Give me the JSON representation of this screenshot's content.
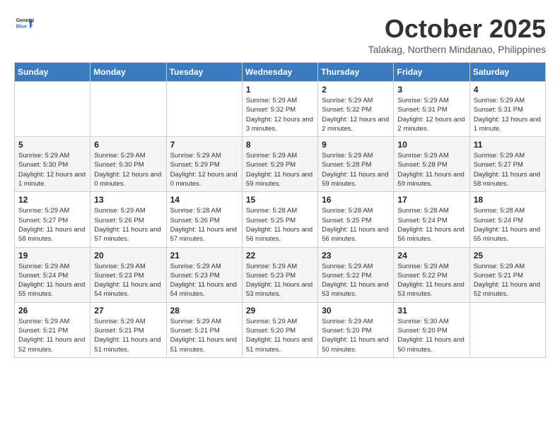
{
  "header": {
    "logo_general": "General",
    "logo_blue": "Blue",
    "month": "October 2025",
    "location": "Talakag, Northern Mindanao, Philippines"
  },
  "weekdays": [
    "Sunday",
    "Monday",
    "Tuesday",
    "Wednesday",
    "Thursday",
    "Friday",
    "Saturday"
  ],
  "weeks": [
    [
      {
        "day": "",
        "info": ""
      },
      {
        "day": "",
        "info": ""
      },
      {
        "day": "",
        "info": ""
      },
      {
        "day": "1",
        "info": "Sunrise: 5:29 AM\nSunset: 5:32 PM\nDaylight: 12 hours and 3 minutes."
      },
      {
        "day": "2",
        "info": "Sunrise: 5:29 AM\nSunset: 5:32 PM\nDaylight: 12 hours and 2 minutes."
      },
      {
        "day": "3",
        "info": "Sunrise: 5:29 AM\nSunset: 5:31 PM\nDaylight: 12 hours and 2 minutes."
      },
      {
        "day": "4",
        "info": "Sunrise: 5:29 AM\nSunset: 5:31 PM\nDaylight: 12 hours and 1 minute."
      }
    ],
    [
      {
        "day": "5",
        "info": "Sunrise: 5:29 AM\nSunset: 5:30 PM\nDaylight: 12 hours and 1 minute."
      },
      {
        "day": "6",
        "info": "Sunrise: 5:29 AM\nSunset: 5:30 PM\nDaylight: 12 hours and 0 minutes."
      },
      {
        "day": "7",
        "info": "Sunrise: 5:29 AM\nSunset: 5:29 PM\nDaylight: 12 hours and 0 minutes."
      },
      {
        "day": "8",
        "info": "Sunrise: 5:29 AM\nSunset: 5:29 PM\nDaylight: 11 hours and 59 minutes."
      },
      {
        "day": "9",
        "info": "Sunrise: 5:29 AM\nSunset: 5:28 PM\nDaylight: 11 hours and 59 minutes."
      },
      {
        "day": "10",
        "info": "Sunrise: 5:29 AM\nSunset: 5:28 PM\nDaylight: 11 hours and 59 minutes."
      },
      {
        "day": "11",
        "info": "Sunrise: 5:29 AM\nSunset: 5:27 PM\nDaylight: 11 hours and 58 minutes."
      }
    ],
    [
      {
        "day": "12",
        "info": "Sunrise: 5:29 AM\nSunset: 5:27 PM\nDaylight: 11 hours and 58 minutes."
      },
      {
        "day": "13",
        "info": "Sunrise: 5:29 AM\nSunset: 5:26 PM\nDaylight: 11 hours and 57 minutes."
      },
      {
        "day": "14",
        "info": "Sunrise: 5:28 AM\nSunset: 5:26 PM\nDaylight: 11 hours and 57 minutes."
      },
      {
        "day": "15",
        "info": "Sunrise: 5:28 AM\nSunset: 5:25 PM\nDaylight: 11 hours and 56 minutes."
      },
      {
        "day": "16",
        "info": "Sunrise: 5:28 AM\nSunset: 5:25 PM\nDaylight: 11 hours and 56 minutes."
      },
      {
        "day": "17",
        "info": "Sunrise: 5:28 AM\nSunset: 5:24 PM\nDaylight: 11 hours and 56 minutes."
      },
      {
        "day": "18",
        "info": "Sunrise: 5:28 AM\nSunset: 5:24 PM\nDaylight: 11 hours and 55 minutes."
      }
    ],
    [
      {
        "day": "19",
        "info": "Sunrise: 5:29 AM\nSunset: 5:24 PM\nDaylight: 11 hours and 55 minutes."
      },
      {
        "day": "20",
        "info": "Sunrise: 5:29 AM\nSunset: 5:23 PM\nDaylight: 11 hours and 54 minutes."
      },
      {
        "day": "21",
        "info": "Sunrise: 5:29 AM\nSunset: 5:23 PM\nDaylight: 11 hours and 54 minutes."
      },
      {
        "day": "22",
        "info": "Sunrise: 5:29 AM\nSunset: 5:23 PM\nDaylight: 11 hours and 53 minutes."
      },
      {
        "day": "23",
        "info": "Sunrise: 5:29 AM\nSunset: 5:22 PM\nDaylight: 11 hours and 53 minutes."
      },
      {
        "day": "24",
        "info": "Sunrise: 5:29 AM\nSunset: 5:22 PM\nDaylight: 11 hours and 53 minutes."
      },
      {
        "day": "25",
        "info": "Sunrise: 5:29 AM\nSunset: 5:21 PM\nDaylight: 11 hours and 52 minutes."
      }
    ],
    [
      {
        "day": "26",
        "info": "Sunrise: 5:29 AM\nSunset: 5:21 PM\nDaylight: 11 hours and 52 minutes."
      },
      {
        "day": "27",
        "info": "Sunrise: 5:29 AM\nSunset: 5:21 PM\nDaylight: 11 hours and 51 minutes."
      },
      {
        "day": "28",
        "info": "Sunrise: 5:29 AM\nSunset: 5:21 PM\nDaylight: 11 hours and 51 minutes."
      },
      {
        "day": "29",
        "info": "Sunrise: 5:29 AM\nSunset: 5:20 PM\nDaylight: 11 hours and 51 minutes."
      },
      {
        "day": "30",
        "info": "Sunrise: 5:29 AM\nSunset: 5:20 PM\nDaylight: 11 hours and 50 minutes."
      },
      {
        "day": "31",
        "info": "Sunrise: 5:30 AM\nSunset: 5:20 PM\nDaylight: 11 hours and 50 minutes."
      },
      {
        "day": "",
        "info": ""
      }
    ]
  ]
}
